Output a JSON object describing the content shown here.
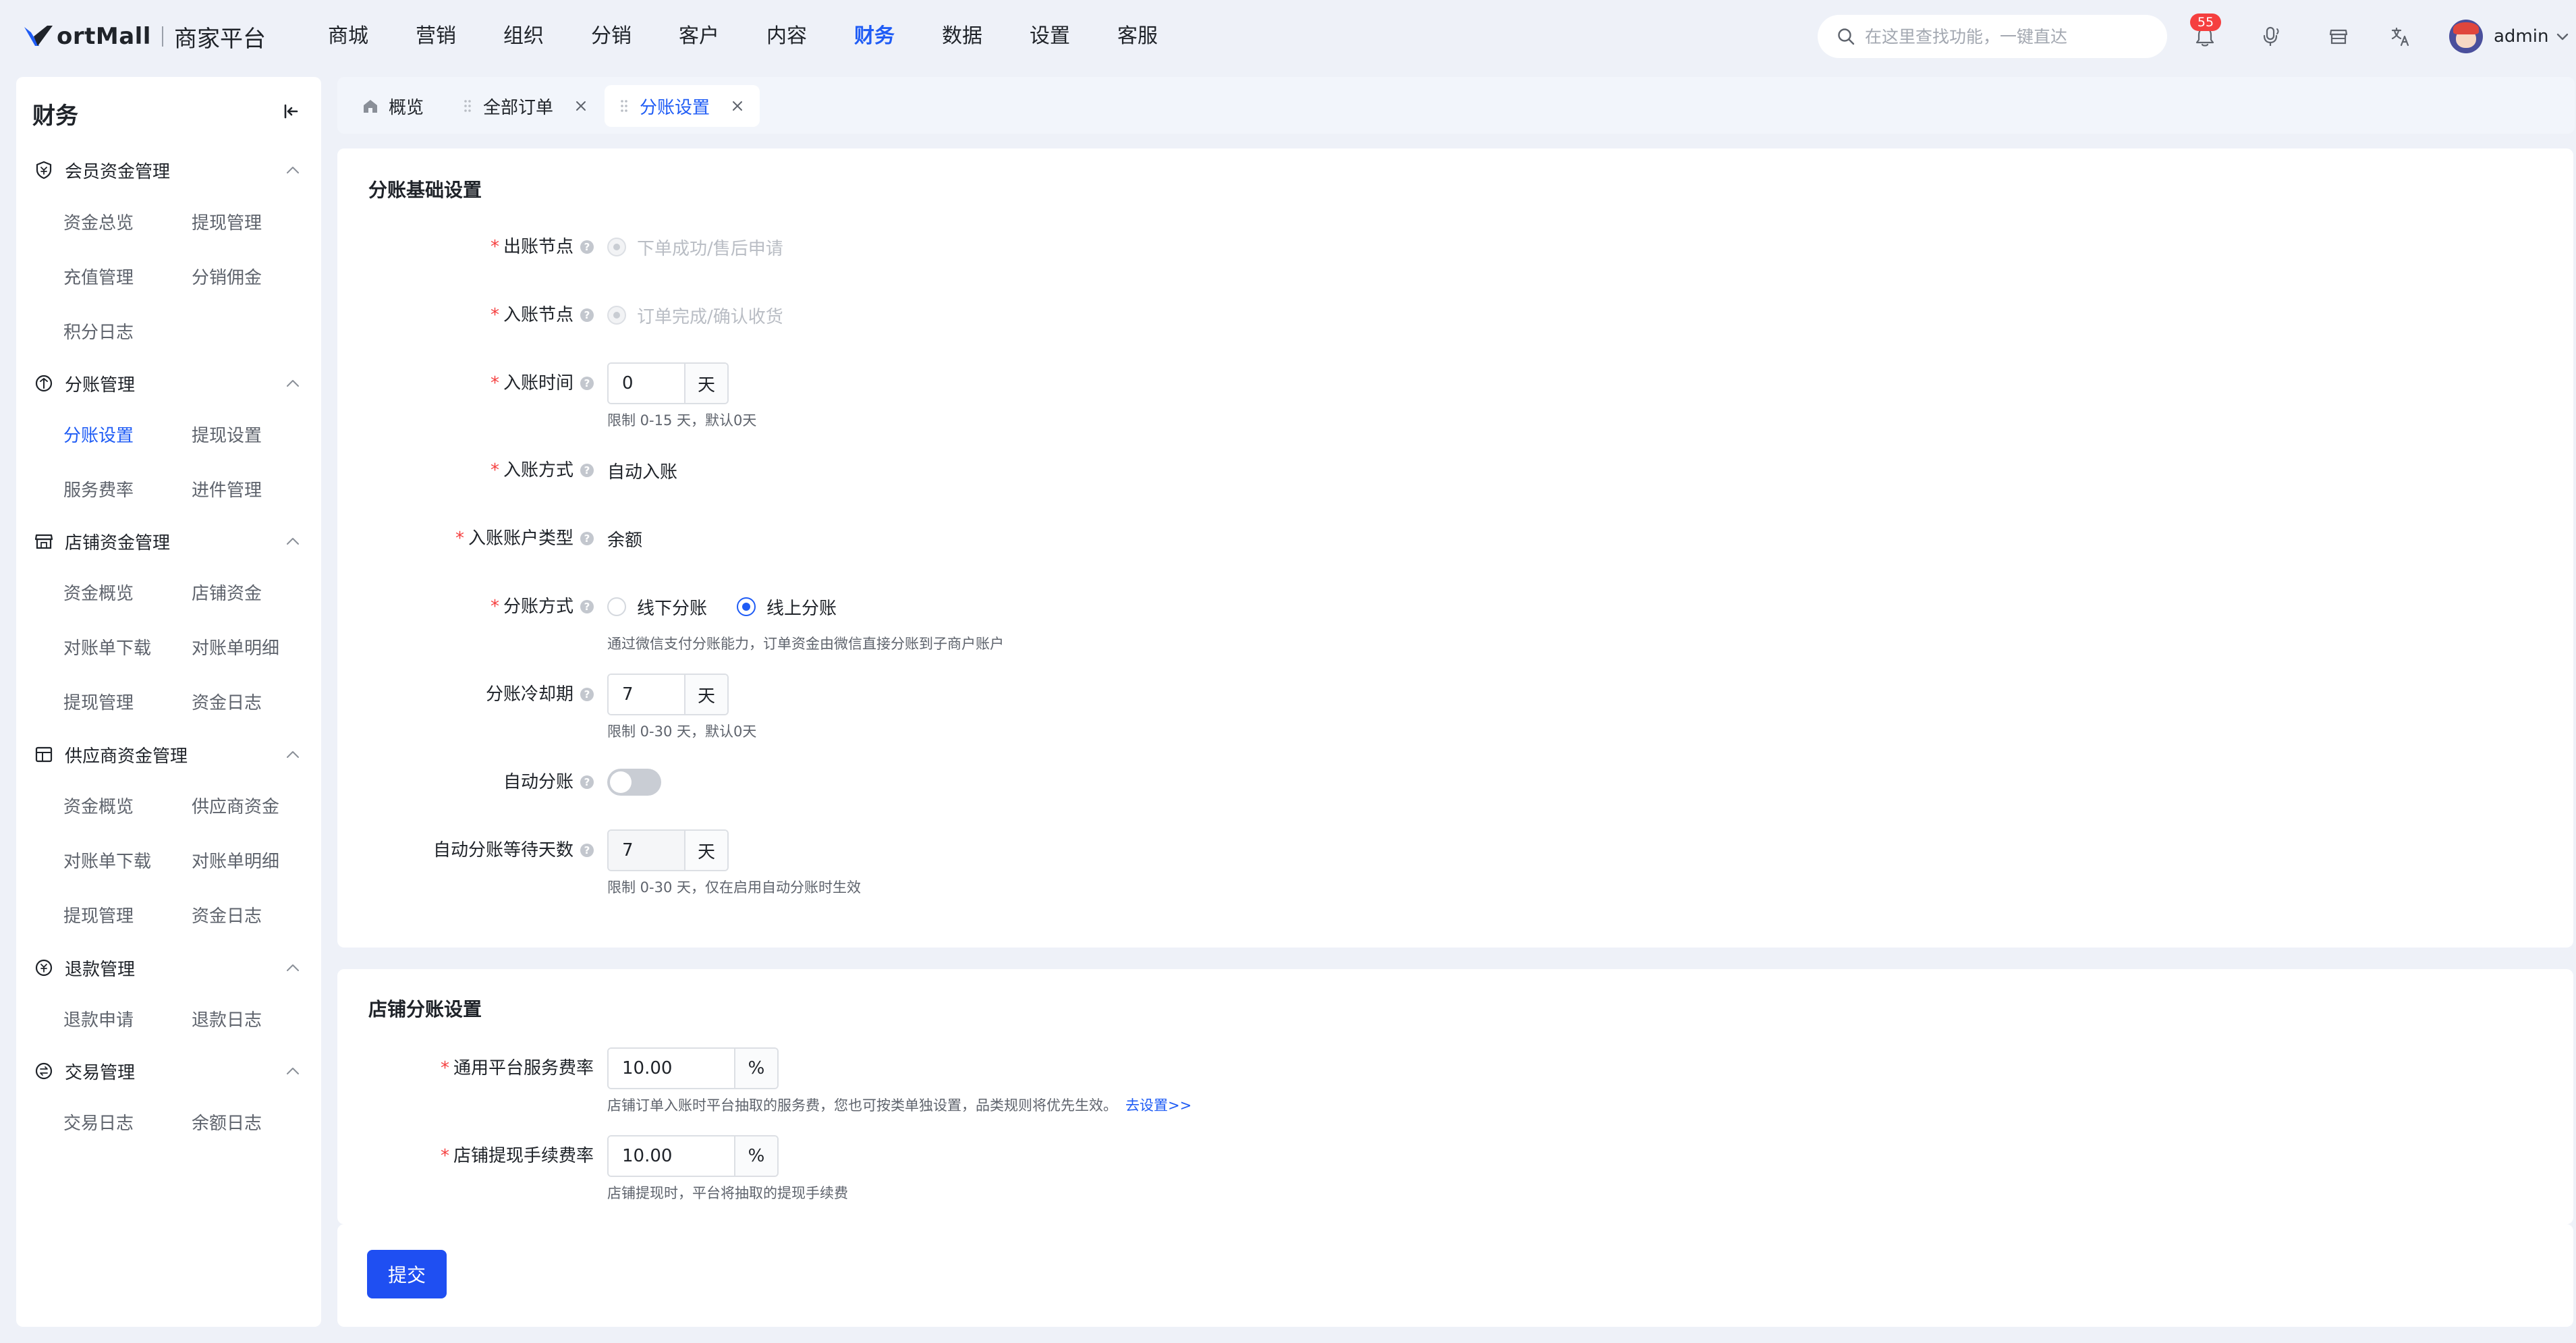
{
  "app": {
    "brand": "ortMall",
    "subtitle": "商家平台"
  },
  "nav": {
    "items": [
      "商城",
      "营销",
      "组织",
      "分销",
      "客户",
      "内容",
      "财务",
      "数据",
      "设置",
      "客服"
    ],
    "active_index": 6
  },
  "search": {
    "placeholder": "在这里查找功能，一键直达"
  },
  "notifications": {
    "count": "55"
  },
  "user": {
    "name": "admin"
  },
  "sidebar": {
    "title": "财务",
    "groups": [
      {
        "label": "会员资金管理",
        "icon": "shield-icon",
        "items": [
          "资金总览",
          "提现管理",
          "充值管理",
          "分销佣金",
          "积分日志"
        ]
      },
      {
        "label": "分账管理",
        "icon": "split-icon",
        "items": [
          "分账设置",
          "提现设置",
          "服务费率",
          "进件管理"
        ]
      },
      {
        "label": "店铺资金管理",
        "icon": "store-icon",
        "items": [
          "资金概览",
          "店铺资金",
          "对账单下载",
          "对账单明细",
          "提现管理",
          "资金日志"
        ]
      },
      {
        "label": "供应商资金管理",
        "icon": "supplier-icon",
        "items": [
          "资金概览",
          "供应商资金",
          "对账单下载",
          "对账单明细",
          "提现管理",
          "资金日志"
        ]
      },
      {
        "label": "退款管理",
        "icon": "refund-icon",
        "items": [
          "退款申请",
          "退款日志"
        ]
      },
      {
        "label": "交易管理",
        "icon": "trade-icon",
        "items": [
          "交易日志",
          "余额日志"
        ]
      }
    ],
    "active_item": "分账设置"
  },
  "tabs": [
    {
      "label": "概览",
      "closable": false
    },
    {
      "label": "全部订单",
      "closable": true
    },
    {
      "label": "分账设置",
      "closable": true,
      "active": true
    }
  ],
  "basic": {
    "title": "分账基础设置",
    "out_node": {
      "label": "出账节点",
      "option": "下单成功/售后申请"
    },
    "in_node": {
      "label": "入账节点",
      "option": "订单完成/确认收货"
    },
    "in_time": {
      "label": "入账时间",
      "value": "0",
      "unit": "天",
      "hint": "限制 0-15 天，默认0天"
    },
    "in_method": {
      "label": "入账方式",
      "value": "自动入账"
    },
    "account_type": {
      "label": "入账账户类型",
      "value": "余额"
    },
    "split_mode": {
      "label": "分账方式",
      "options": [
        "线下分账",
        "线上分账"
      ],
      "selected": "线上分账",
      "hint": "通过微信支付分账能力，订单资金由微信直接分账到子商户账户"
    },
    "cooldown": {
      "label": "分账冷却期",
      "value": "7",
      "unit": "天",
      "hint": "限制 0-30 天，默认0天"
    },
    "auto_split": {
      "label": "自动分账",
      "enabled": false
    },
    "auto_wait": {
      "label": "自动分账等待天数",
      "value": "7",
      "unit": "天",
      "hint": "限制 0-30 天，仅在启用自动分账时生效"
    }
  },
  "store": {
    "title": "店铺分账设置",
    "platform_rate": {
      "label": "通用平台服务费率",
      "value": "10.00",
      "unit": "%",
      "hint": "店铺订单入账时平台抽取的服务费，您也可按类单独设置，品类规则将优先生效。",
      "link": "去设置>>"
    },
    "withdraw_rate": {
      "label": "店铺提现手续费率",
      "value": "10.00",
      "unit": "%",
      "hint": "店铺提现时，平台将抽取的提现手续费"
    }
  },
  "actions": {
    "submit": "提交"
  },
  "colors": {
    "accent": "#1f5cf5",
    "required": "#f53f3f",
    "badge": "#f53f3f"
  }
}
